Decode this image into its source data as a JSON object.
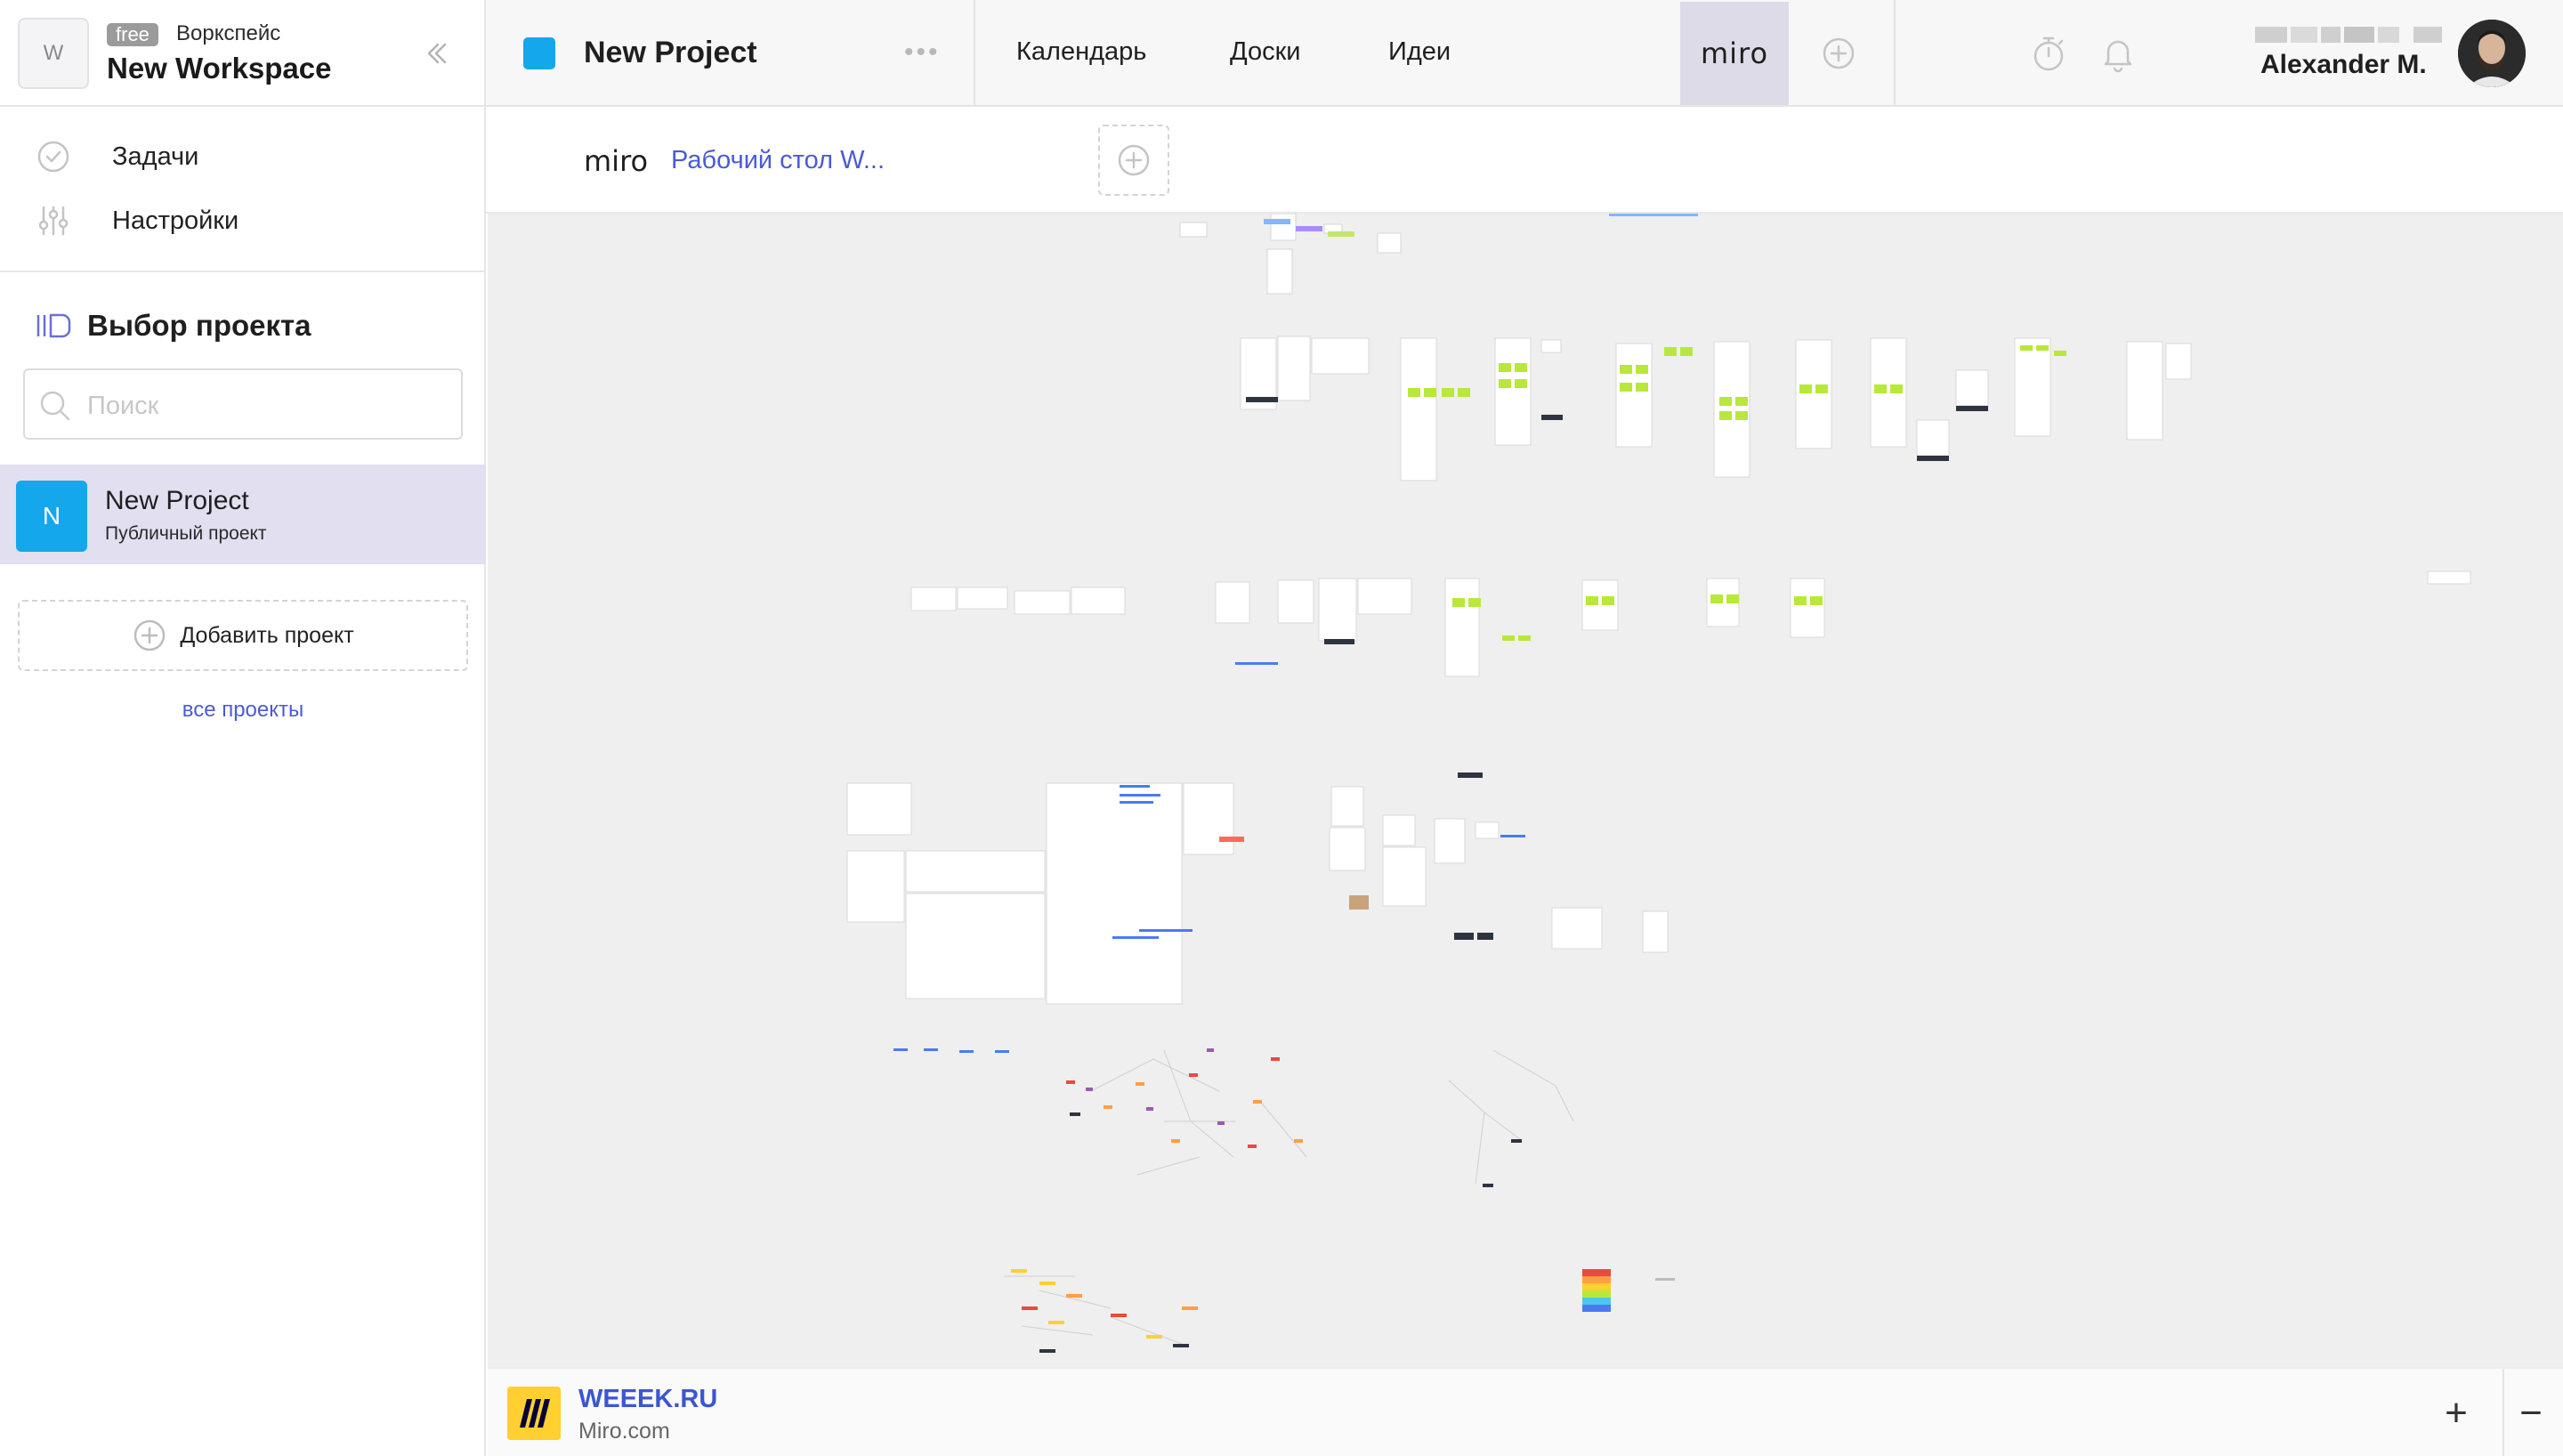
{
  "workspace": {
    "logo_letter": "W",
    "plan_tag": "free",
    "kind_label": "Воркспейс",
    "name": "New Workspace",
    "collapse_icon": "chevron-double-left-icon"
  },
  "sidebar": {
    "nav": [
      {
        "label": "Задачи",
        "icon": "check-circle-icon"
      },
      {
        "label": "Настройки",
        "icon": "sliders-icon"
      }
    ],
    "picker_title": "Выбор проекта",
    "search_placeholder": "Поиск",
    "projects": [
      {
        "avatar": "N",
        "name": "New Project",
        "subtitle": "Публичный проект",
        "color": "#14a7ec",
        "selected": true
      }
    ],
    "add_project_label": "Добавить проект",
    "all_projects_link": "все проекты"
  },
  "topbar": {
    "project_title": "New Project",
    "tabs": [
      "Календарь",
      "Доски",
      "Идеи"
    ],
    "active_integration": "miro",
    "user_name": "Alexander M."
  },
  "subheader": {
    "logo": "miro",
    "board_name": "Рабочий стол W..."
  },
  "footer": {
    "title": "WEEEK.RU",
    "subtitle": "Miro.com",
    "zoom_in_label": "+",
    "zoom_out_label": "−"
  },
  "colors": {
    "accent": "#4a5bd6",
    "project_blue": "#14a7ec",
    "selected_row": "#e1dff0",
    "canvas_bg": "#efefef",
    "miro_yellow": "#ffd02f"
  }
}
